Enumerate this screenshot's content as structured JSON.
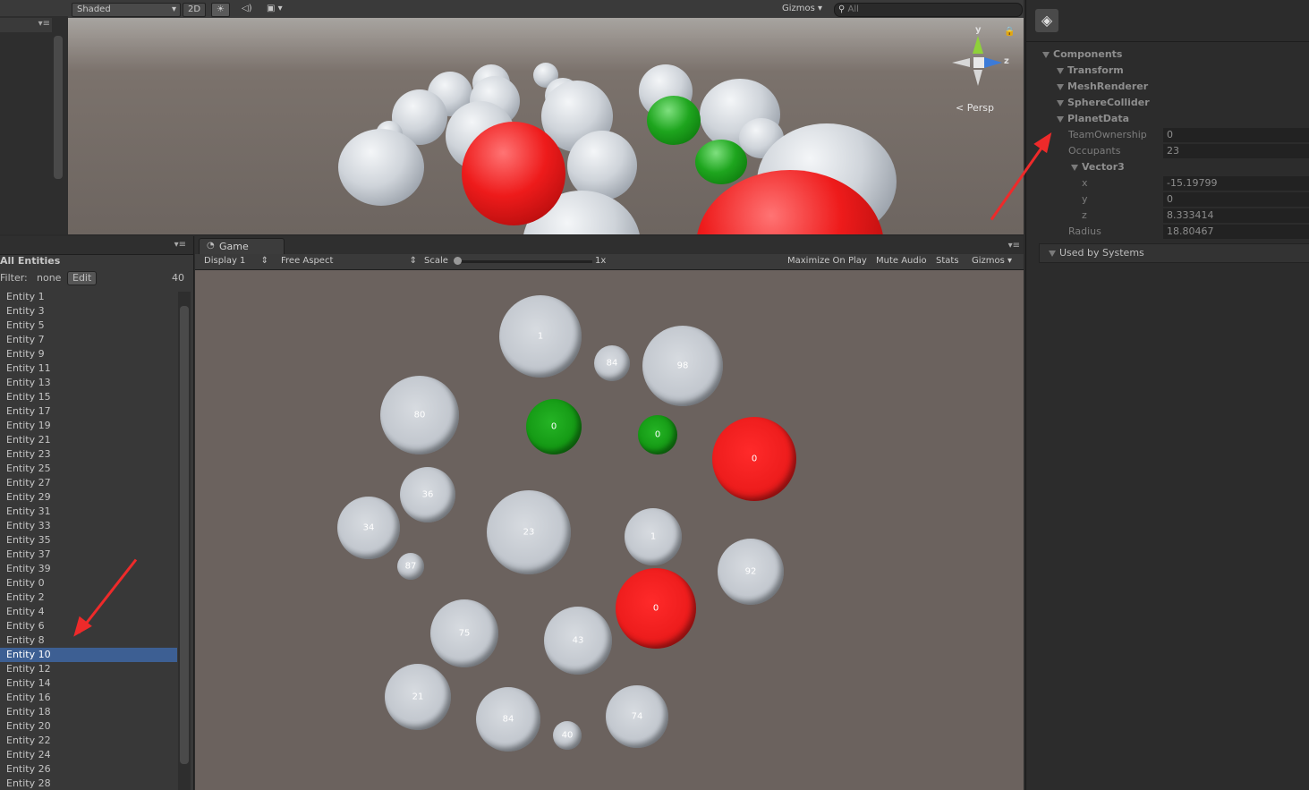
{
  "scene": {
    "toolbar": {
      "shading_mode": "Shaded",
      "mode_2d": "2D",
      "gizmos": "Gizmos",
      "search_placeholder": "All"
    },
    "gizmo": {
      "y": "y",
      "z": "z",
      "projection": "Persp"
    }
  },
  "hierarchy": {
    "title": "All Entities",
    "filter_label": "Filter:",
    "filter_value": "none",
    "edit_button": "Edit",
    "count": "40",
    "entities": [
      "Entity 1",
      "Entity 3",
      "Entity 5",
      "Entity 7",
      "Entity 9",
      "Entity 11",
      "Entity 13",
      "Entity 15",
      "Entity 17",
      "Entity 19",
      "Entity 21",
      "Entity 23",
      "Entity 25",
      "Entity 27",
      "Entity 29",
      "Entity 31",
      "Entity 33",
      "Entity 35",
      "Entity 37",
      "Entity 39",
      "Entity 0",
      "Entity 2",
      "Entity 4",
      "Entity 6",
      "Entity 8",
      "Entity 10",
      "Entity 12",
      "Entity 14",
      "Entity 16",
      "Entity 18",
      "Entity 20",
      "Entity 22",
      "Entity 24",
      "Entity 26",
      "Entity 28"
    ],
    "selected": "Entity 10"
  },
  "game": {
    "tab_label": "Game",
    "display": "Display 1",
    "aspect": "Free Aspect",
    "scale_label": "Scale",
    "scale_value": "1x",
    "maximize": "Maximize On Play",
    "mute": "Mute Audio",
    "stats": "Stats",
    "gizmos": "Gizmos",
    "planets": [
      {
        "label": "1",
        "color": "grey"
      },
      {
        "label": "84",
        "color": "grey"
      },
      {
        "label": "98",
        "color": "grey"
      },
      {
        "label": "80",
        "color": "grey"
      },
      {
        "label": "0",
        "color": "green"
      },
      {
        "label": "0",
        "color": "green"
      },
      {
        "label": "0",
        "color": "red"
      },
      {
        "label": "36",
        "color": "grey"
      },
      {
        "label": "34",
        "color": "grey"
      },
      {
        "label": "23",
        "color": "grey"
      },
      {
        "label": "1",
        "color": "grey"
      },
      {
        "label": "92",
        "color": "grey"
      },
      {
        "label": "87",
        "color": "grey"
      },
      {
        "label": "0",
        "color": "red"
      },
      {
        "label": "75",
        "color": "grey"
      },
      {
        "label": "43",
        "color": "grey"
      },
      {
        "label": "21",
        "color": "grey"
      },
      {
        "label": "84",
        "color": "grey"
      },
      {
        "label": "40",
        "color": "grey"
      },
      {
        "label": "74",
        "color": "grey"
      }
    ]
  },
  "inspector": {
    "components_label": "Components",
    "components": [
      "Transform",
      "MeshRenderer",
      "SphereCollider",
      "PlanetData"
    ],
    "fields": {
      "team_ownership": {
        "label": "TeamOwnership",
        "value": "0"
      },
      "occupants": {
        "label": "Occupants",
        "value": "23"
      },
      "vector_label": "Vector3",
      "x": {
        "label": "x",
        "value": "-15.19799"
      },
      "y": {
        "label": "y",
        "value": "0"
      },
      "z": {
        "label": "z",
        "value": "8.333414"
      },
      "radius": {
        "label": "Radius",
        "value": "18.80467"
      }
    },
    "used_by": "Used by Systems"
  },
  "colors": {
    "selection": "#3d5f93",
    "annotation_arrow": "#ee2a2a",
    "team_red": "#ee1d1d",
    "team_green": "#159a15"
  }
}
